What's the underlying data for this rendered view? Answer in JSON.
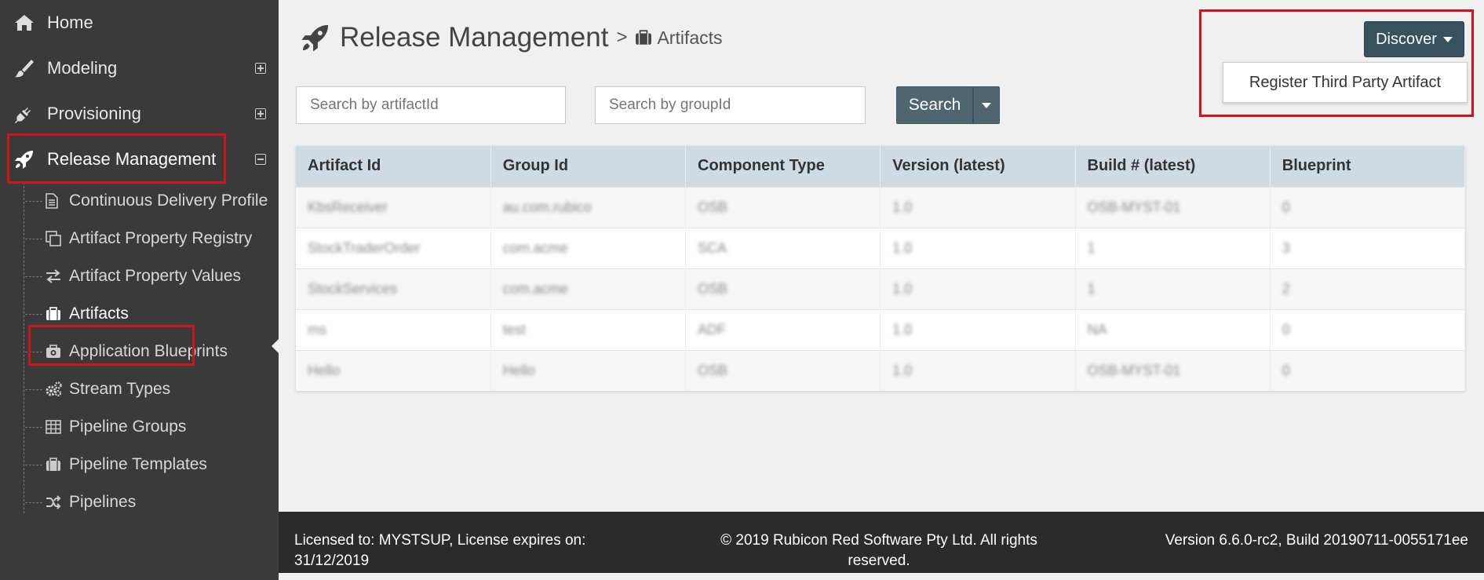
{
  "sidebar": {
    "top_items": [
      {
        "label": "Home",
        "icon": "home-icon",
        "toggle": "none"
      },
      {
        "label": "Modeling",
        "icon": "brush-icon",
        "toggle": "plus"
      },
      {
        "label": "Provisioning",
        "icon": "plug-icon",
        "toggle": "plus"
      },
      {
        "label": "Release Management",
        "icon": "rocket-icon",
        "toggle": "minus"
      }
    ],
    "sub_items": [
      {
        "label": "Continuous Delivery Profile",
        "icon": "document-icon"
      },
      {
        "label": "Artifact Property Registry",
        "icon": "copy-icon"
      },
      {
        "label": "Artifact Property Values",
        "icon": "exchange-icon"
      },
      {
        "label": "Artifacts",
        "icon": "briefcase-icon"
      },
      {
        "label": "Application Blueprints",
        "icon": "camera-briefcase-icon"
      },
      {
        "label": "Stream Types",
        "icon": "gears-icon"
      },
      {
        "label": "Pipeline Groups",
        "icon": "table-icon"
      },
      {
        "label": "Pipeline Templates",
        "icon": "briefcase-icon"
      },
      {
        "label": "Pipelines",
        "icon": "random-icon"
      }
    ]
  },
  "header": {
    "title": "Release Management",
    "separator": ">",
    "current": "Artifacts"
  },
  "discover": {
    "label": "Discover",
    "menu_item": "Register Third Party Artifact"
  },
  "search": {
    "artifact_placeholder": "Search by artifactId",
    "group_placeholder": "Search by groupId",
    "button_label": "Search"
  },
  "table": {
    "columns": [
      "Artifact Id",
      "Group Id",
      "Component Type",
      "Version (latest)",
      "Build # (latest)",
      "Blueprint"
    ],
    "rows": [
      [
        "KbsReceiver",
        "au.com.rubico",
        "OSB",
        "1.0",
        "OSB-MYST-01",
        "0"
      ],
      [
        "StockTraderOrder",
        "com.acme",
        "SCA",
        "1.0",
        "1",
        "3"
      ],
      [
        "StockServices",
        "com.acme",
        "OSB",
        "1.0",
        "1",
        "2"
      ],
      [
        "ms",
        "test",
        "ADF",
        "1.0",
        "NA",
        "0"
      ],
      [
        "Hello",
        "Hello",
        "OSB",
        "1.0",
        "OSB-MYST-01",
        "0"
      ]
    ]
  },
  "footer": {
    "license": "Licensed to: MYSTSUP, License expires on: 31/12/2019",
    "copyright": "© 2019 Rubicon Red Software Pty Ltd. All rights reserved.",
    "version": "Version 6.6.0-rc2, Build 20190711-0055171ee"
  },
  "colors": {
    "sidebar_bg": "#3a3a3a",
    "primary_button": "#37515e",
    "table_header": "#cfdbe2",
    "highlight": "#d0141e"
  }
}
